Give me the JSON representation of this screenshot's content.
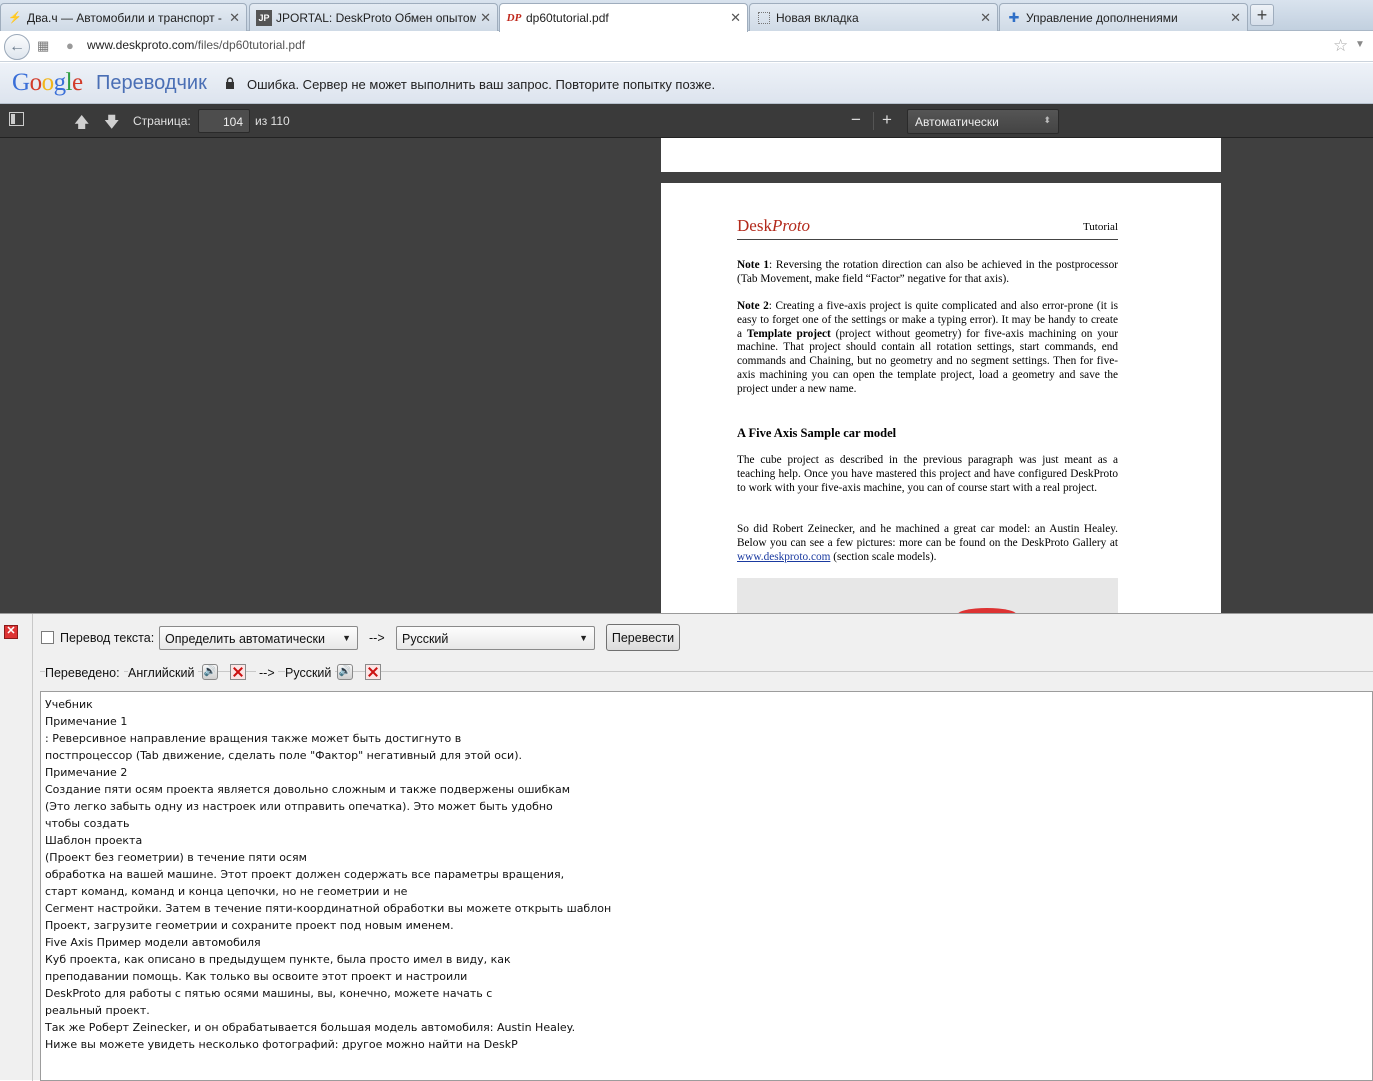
{
  "browser": {
    "tabs": [
      {
        "title": "Два.ч — Автомобили и транспорт -",
        "icon": "lightning-icon",
        "active": false
      },
      {
        "title": "JPORTAL: DeskProto Обмен опытом...",
        "icon": "jp-icon",
        "active": false
      },
      {
        "title": "dp60tutorial.pdf",
        "icon": "dp-icon",
        "active": true
      },
      {
        "title": "Новая вкладка",
        "icon": "blank-page-icon",
        "active": false
      },
      {
        "title": "Управление дополнениями",
        "icon": "puzzle-icon",
        "active": false
      }
    ],
    "url_host": "www.deskproto.com",
    "url_path": "/files/dp60tutorial.pdf"
  },
  "translate_bar": {
    "logo": "Google",
    "product": "Переводчик",
    "message": "Ошибка. Сервер не может выполнить ваш запрос. Повторите попытку позже."
  },
  "pdf_toolbar": {
    "page_label": "Страница:",
    "page_number": "104",
    "page_of": "из 110",
    "zoom_value": "Автоматически"
  },
  "pdf_page": {
    "logo_desk": "Desk",
    "logo_proto": "Proto",
    "header_tag": "Tutorial",
    "note1_label": "Note 1",
    "note1_text": ": Reversing the rotation direction can also be achieved in the postprocessor (Tab Movement, make field “Factor” negative for that axis).",
    "note2_label": "Note 2",
    "note2_text_a": ": Creating a five-axis project is quite complicated and also error-prone (it is easy to forget one of the settings or make a typing error). It may be handy to create a ",
    "note2_bold": "Template project",
    "note2_text_b": " (project without geometry) for five-axis machining on your machine. That project should contain all rotation settings, start commands, end commands and Chaining, but no geometry and no segment settings. Then for five-axis machining you can open the template project, load a geometry and save the project under a new name.",
    "heading": "A Five Axis Sample car model",
    "para1": "The cube project as described in the previous paragraph was just meant as a teaching help. Once you have mastered this project and have configured DeskProto to work with your five-axis machine, you can of course start with a real project.",
    "para2_a": "So did Robert Zeinecker, and he machined a great car model: an Austin Healey. Below you can see a few pictures: more can be found on the DeskProto Gallery at ",
    "para2_link": "www.deskproto.com",
    "para2_b": "  (section scale models)."
  },
  "translator_panel": {
    "translate_label": "Перевод текста:",
    "source_lang": "Определить автоматически",
    "arrow": "-->",
    "target_lang": "Русский",
    "translate_button": "Перевести",
    "translated_label": "Переведено:",
    "from_lang": "Английский",
    "to_lang": "Русский",
    "lines": [
      "Учебник",
      "Примечание 1",
      ": Реверсивное направление вращения также может быть достигнуто в",
      "постпроцессор (Tab движение, сделать поле \"Фактор\" негативный для этой оси).",
      "Примечание 2",
      "Создание пяти осям проекта является довольно сложным и также подвержены ошибкам",
      "(Это легко забыть одну из настроек или отправить опечатка). Это может быть удобно",
      "чтобы создать",
      "Шаблон проекта",
      "(Проект без геометрии) в течение пяти осям",
      "обработка на вашей машине. Этот проект должен содержать все параметры вращения,",
      "старт команд, команд и конца цепочки, но не геометрии и не",
      "Сегмент настройки. Затем в течение пяти-координатной обработки вы можете открыть шаблон",
      "Проект, загрузите геометрии и сохраните проект под новым именем.",
      "Five Axis Пример модели автомобиля",
      "Куб проекта, как описано в предыдущем пункте, была просто имел в виду, как",
      "преподавании помощь. Как только вы освоите этот проект и настроили",
      "DeskProto для работы с пятью осями машины, вы, конечно, можете начать с",
      "реальный проект.",
      "Так же Роберт Zeinecker, и он обрабатывается большая модель автомобиля: Austin Healey.",
      "Ниже вы можете увидеть несколько фотографий: другое можно найти на DeskP"
    ]
  }
}
